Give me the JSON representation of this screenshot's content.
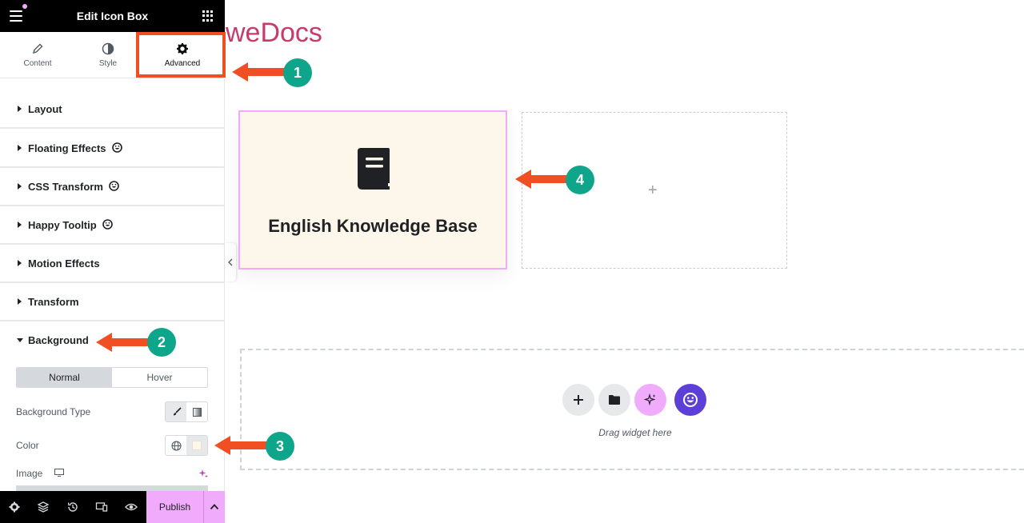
{
  "sidebar": {
    "title": "Edit Icon Box",
    "tabs": [
      {
        "label": "Content",
        "icon": "pencil-icon"
      },
      {
        "label": "Style",
        "icon": "half-circle-icon"
      },
      {
        "label": "Advanced",
        "icon": "gear-icon"
      }
    ],
    "active_tab": "Advanced",
    "sections": [
      {
        "label": "Layout",
        "expanded": false
      },
      {
        "label": "Floating Effects",
        "expanded": false,
        "badge_icon": "happy-addons-icon"
      },
      {
        "label": "CSS Transform",
        "expanded": false,
        "badge_icon": "happy-addons-icon"
      },
      {
        "label": "Happy Tooltip",
        "expanded": false,
        "badge_icon": "happy-addons-icon"
      },
      {
        "label": "Motion Effects",
        "expanded": false
      },
      {
        "label": "Transform",
        "expanded": false
      },
      {
        "label": "Background",
        "expanded": true
      }
    ],
    "background": {
      "state_tabs": [
        "Normal",
        "Hover"
      ],
      "active_state": "Normal",
      "type_label": "Background Type",
      "color_label": "Color",
      "image_label": "Image",
      "color_swatch": "#fdf6ea"
    },
    "footer": {
      "publish_label": "Publish"
    }
  },
  "canvas": {
    "brand_text": "weDocs",
    "iconbox_title": "English Knowledge Base",
    "dropzone_text": "Drag widget here",
    "empty_column_plus": "+"
  },
  "annotations": {
    "badges": [
      "1",
      "2",
      "3",
      "4"
    ],
    "arrow_color": "#f04e23",
    "badge_color": "#0fa58b"
  },
  "colors": {
    "brand": "#c73a6c",
    "accent_pink": "#f0abfc",
    "iconbox_bg": "#fdf6ea",
    "happy_purple": "#5c3fd6"
  }
}
